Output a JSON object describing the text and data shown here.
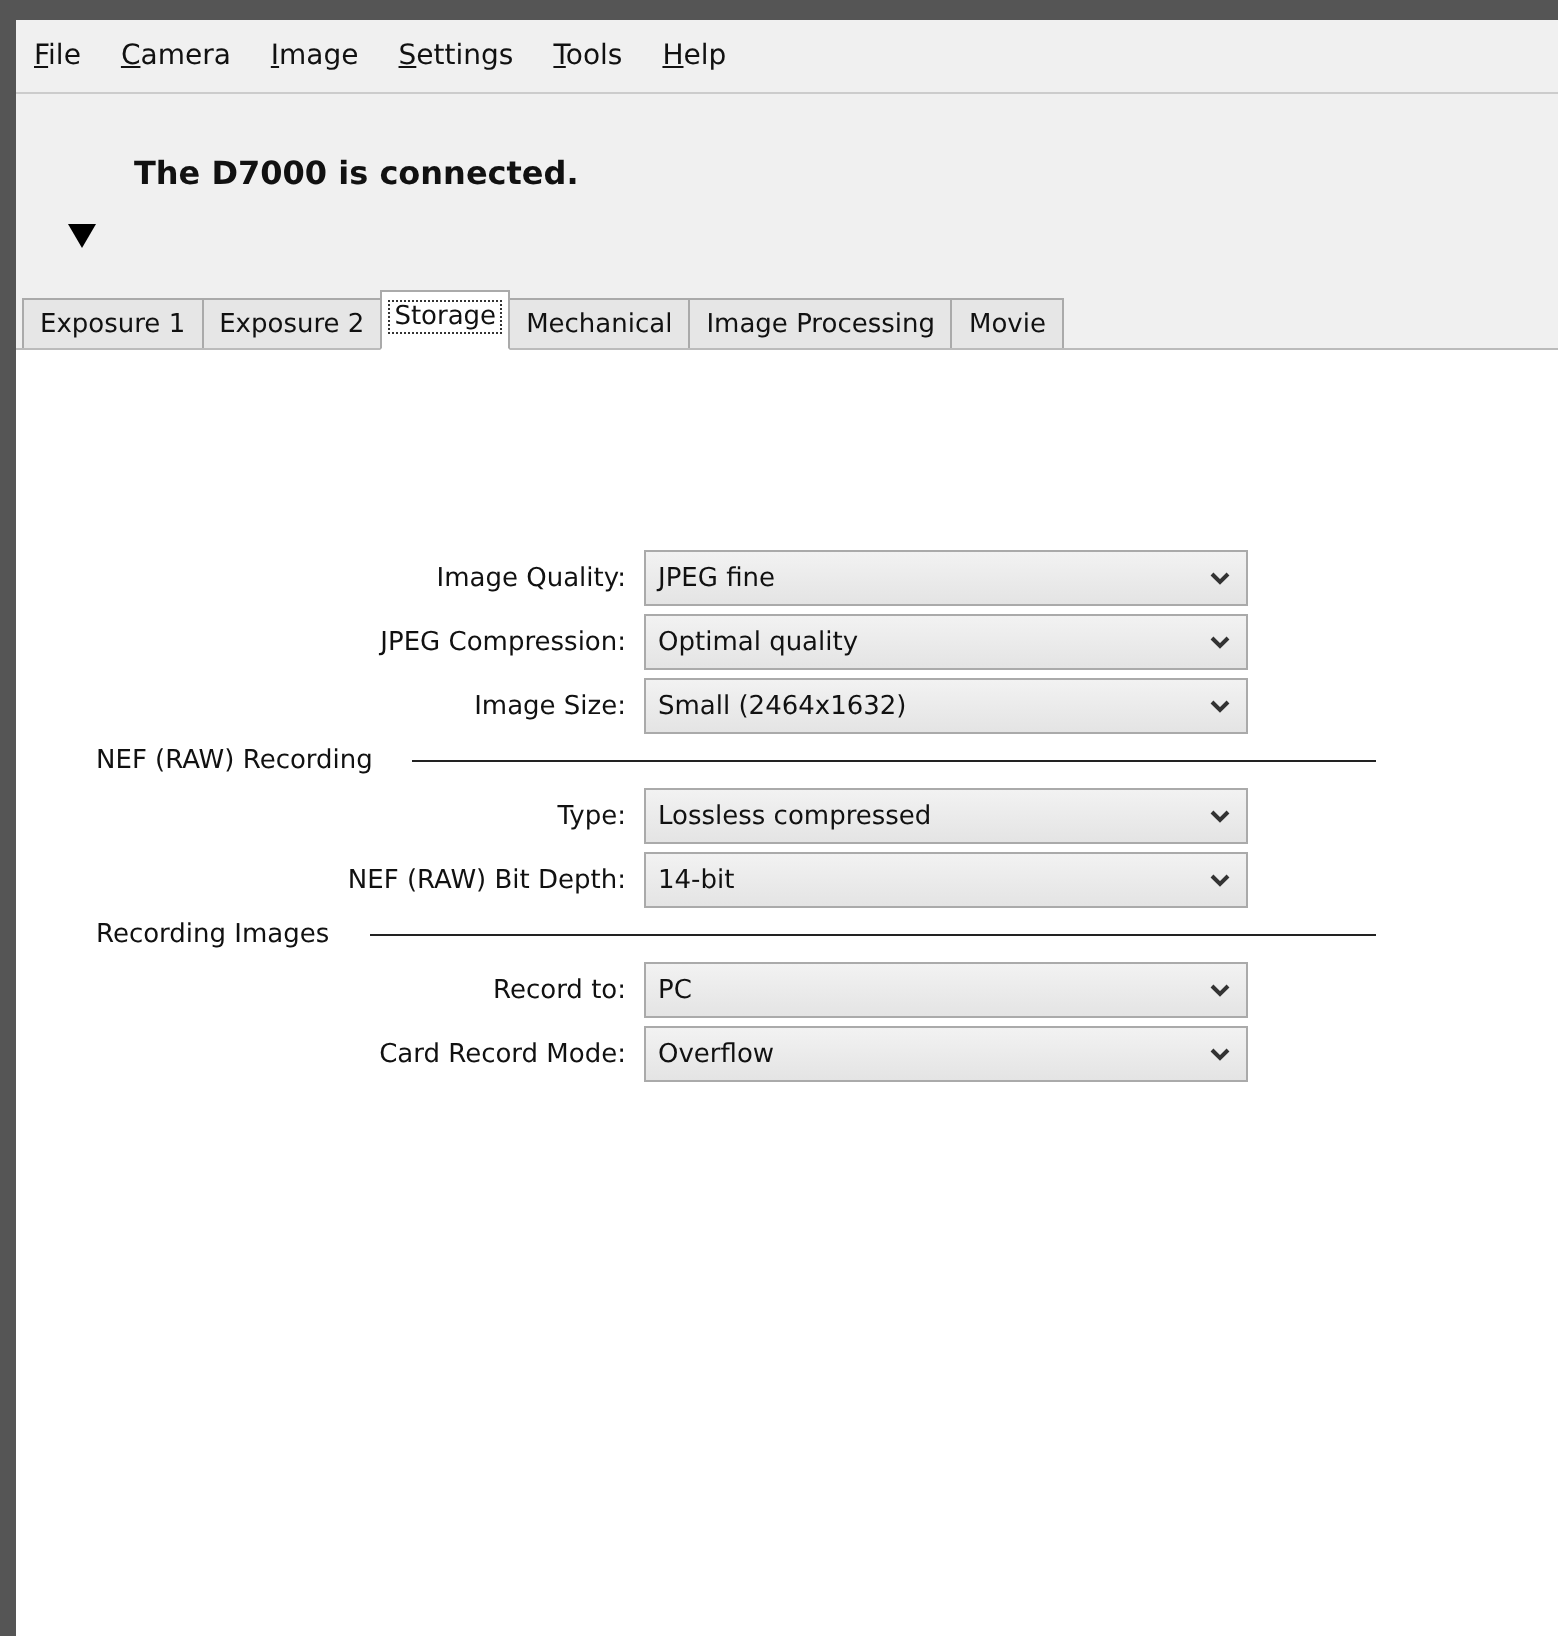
{
  "menu": [
    "File",
    "Camera",
    "Image",
    "Settings",
    "Tools",
    "Help"
  ],
  "status": {
    "message": "The D7000 is connected.",
    "expanded": true
  },
  "tabs": [
    {
      "label": "Exposure 1",
      "selected": false
    },
    {
      "label": "Exposure 2",
      "selected": false
    },
    {
      "label": "Storage",
      "selected": true
    },
    {
      "label": "Mechanical",
      "selected": false
    },
    {
      "label": "Image Processing",
      "selected": false
    },
    {
      "label": "Movie",
      "selected": false
    }
  ],
  "groups": [
    {
      "fields": [
        {
          "label": "Image Quality:",
          "value": "JPEG fine"
        },
        {
          "label": "JPEG Compression:",
          "value": "Optimal quality"
        },
        {
          "label": "Image Size:",
          "value": "Small (2464x1632)"
        }
      ]
    },
    {
      "title": "NEF (RAW) Recording",
      "fields": [
        {
          "label": "Type:",
          "value": "Lossless compressed"
        },
        {
          "label": "NEF (RAW) Bit Depth:",
          "value": "14-bit"
        }
      ]
    },
    {
      "title": "Recording Images",
      "fields": [
        {
          "label": "Record to:",
          "value": "PC"
        },
        {
          "label": "Card Record Mode:",
          "value": "Overflow"
        }
      ]
    }
  ]
}
